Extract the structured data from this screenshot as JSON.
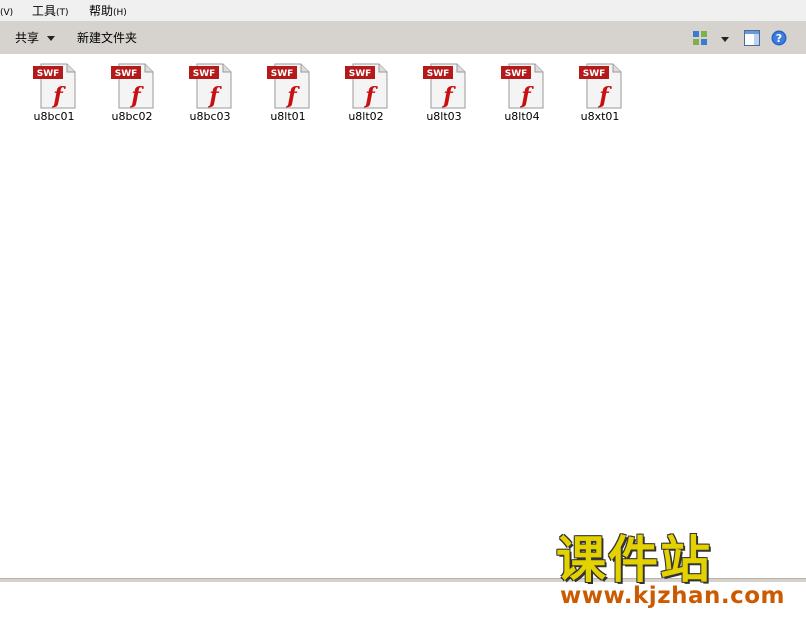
{
  "menubar": {
    "items": [
      {
        "label": "(V)"
      },
      {
        "label": "工具",
        "hotkey": "(T)"
      },
      {
        "label": "帮助",
        "hotkey": "(H)"
      }
    ]
  },
  "toolbar": {
    "share_label": "共享",
    "new_folder_label": "新建文件夹"
  },
  "files": [
    {
      "name": "u8bc01",
      "badge": "SWF",
      "glyph": "f"
    },
    {
      "name": "u8bc02",
      "badge": "SWF",
      "glyph": "f"
    },
    {
      "name": "u8bc03",
      "badge": "SWF",
      "glyph": "f"
    },
    {
      "name": "u8lt01",
      "badge": "SWF",
      "glyph": "f"
    },
    {
      "name": "u8lt02",
      "badge": "SWF",
      "glyph": "f"
    },
    {
      "name": "u8lt03",
      "badge": "SWF",
      "glyph": "f"
    },
    {
      "name": "u8lt04",
      "badge": "SWF",
      "glyph": "f"
    },
    {
      "name": "u8xt01",
      "badge": "SWF",
      "glyph": "f"
    }
  ],
  "watermark": {
    "title": "课件站",
    "url": "www.kjzhan.com"
  },
  "colors": {
    "swf_badge": "#b51a1a",
    "flash_glyph": "#c81010",
    "watermark_title": "#e3d200",
    "watermark_url": "#cc5a00"
  }
}
